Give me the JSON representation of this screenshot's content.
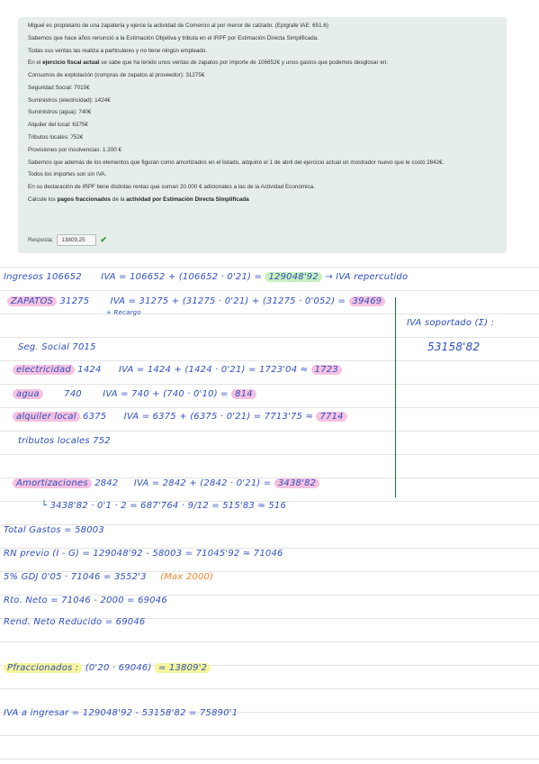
{
  "problem": {
    "lines": [
      "Miguel es propietario de una zapatería y ejerce la actividad de Comercio al por menor de calzado. (Epígrafe IAE: 651.6)",
      "Sabemos que hace años renunció a la Estimación Objetiva y tributa en el IRPF por Estimación Directa Simplificada.",
      "Todas sus ventas las realiza a particulares y no tiene ningún empleado."
    ],
    "fiscal_pre": "En el ",
    "fiscal_bold": "ejercicio fiscal actual",
    "fiscal_post": " se sabe que ha tenido unos ventas de zapatos por importe de 106652€ y unos gastos que podemos desglosar en:",
    "expenses": [
      "Consumos de explotación (compras de zapatos al proveedor): 31275€",
      "Seguridad Social: 7015€",
      "Suministros (electricidad): 1424€",
      "Suministros (agua): 740€",
      "Alquiler del local: 6375€",
      "Tributos locales: 752€",
      "Provisiones por insolvencias: 1.200 €"
    ],
    "extra": [
      "Sabemos que además de los elementos que figuran como amortizados en el listado, adquirió el 1 de abril del ejercicio actual un mostrador nuevo que le costó 2842€.",
      "Todos los importes son sin IVA.",
      "En su declaración de IRPF tiene distintas rentas que suman 20.000 € adicionales a las de la Actividad Económica."
    ],
    "question_pre": "Calcule los ",
    "question_bold1": "pagos fraccionados",
    "question_mid": " de la ",
    "question_bold2": "actividad por Estimación Directa Simplificada",
    "answer_label": "Resposta:",
    "answer_value": "13809,25",
    "check_icon": "check-icon"
  },
  "notes": {
    "ingresos": "Ingresos   106652",
    "ingresos_iva": "IVA = 106652 + (106652 · 0'21) =",
    "ingresos_total": "129048'92",
    "ingresos_after": "→ IVA repercutido",
    "zapatos": "ZAPATOS",
    "zapatos_amt": "31275",
    "zapatos_iva": "IVA = 31275 + (31275 · 0'21) + (31275 · 0'052) =",
    "zapatos_total": "39469",
    "recargo": "+ Recargo",
    "iva_soportado_label": "IVA soportado (Σ) :",
    "iva_soportado_value": "53158'82",
    "seg_social": "Seg. Social   7015",
    "electricidad": "electricidad",
    "electricidad_amt": "1424",
    "electricidad_iva": "IVA = 1424 + (1424 · 0'21) = 1723'04 ≈",
    "electricidad_total": "1723",
    "agua": "agua",
    "agua_amt": "740",
    "agua_iva": "IVA = 740 + (740 · 0'10) =",
    "agua_total": "814",
    "alquiler": "alquiler local",
    "alquiler_amt": "6375",
    "alquiler_iva": "IVA = 6375 + (6375 · 0'21) = 7713'75 ≈",
    "alquiler_total": "7714",
    "tributos": "tributos locales   752",
    "amort": "Amortizaciones",
    "amort_amt": "2842",
    "amort_iva": "IVA = 2842 + (2842 · 0'21) =",
    "amort_total": "3438'82",
    "amort_calc": "└ 3438'82 · 0'1 · 2 = 687'764 · 9/12 = 515'83 ≈ 516",
    "total_gastos": "Total Gastos = 58003",
    "rn_previo": "RN previo (I - G) = 129048'92 - 58003 = 71045'92 ≈ 71046",
    "gdj_pre": "5% GDJ   0'05 · 71046 = 3552'3",
    "gdj_max": "(Max 2000)",
    "rto_neto": "Rto. Neto = 71046 - 2000 = 69046",
    "rend_reducido": "Rend. Neto Reducido = 69046",
    "pfracc_label": "Pfraccionados :",
    "pfracc_expr": "(0'20 · 69046)",
    "pfracc_total": "= 13809'2",
    "iva_ingresar": "IVA a ingresar = 129048'92 - 53158'82 = 75890'1"
  }
}
